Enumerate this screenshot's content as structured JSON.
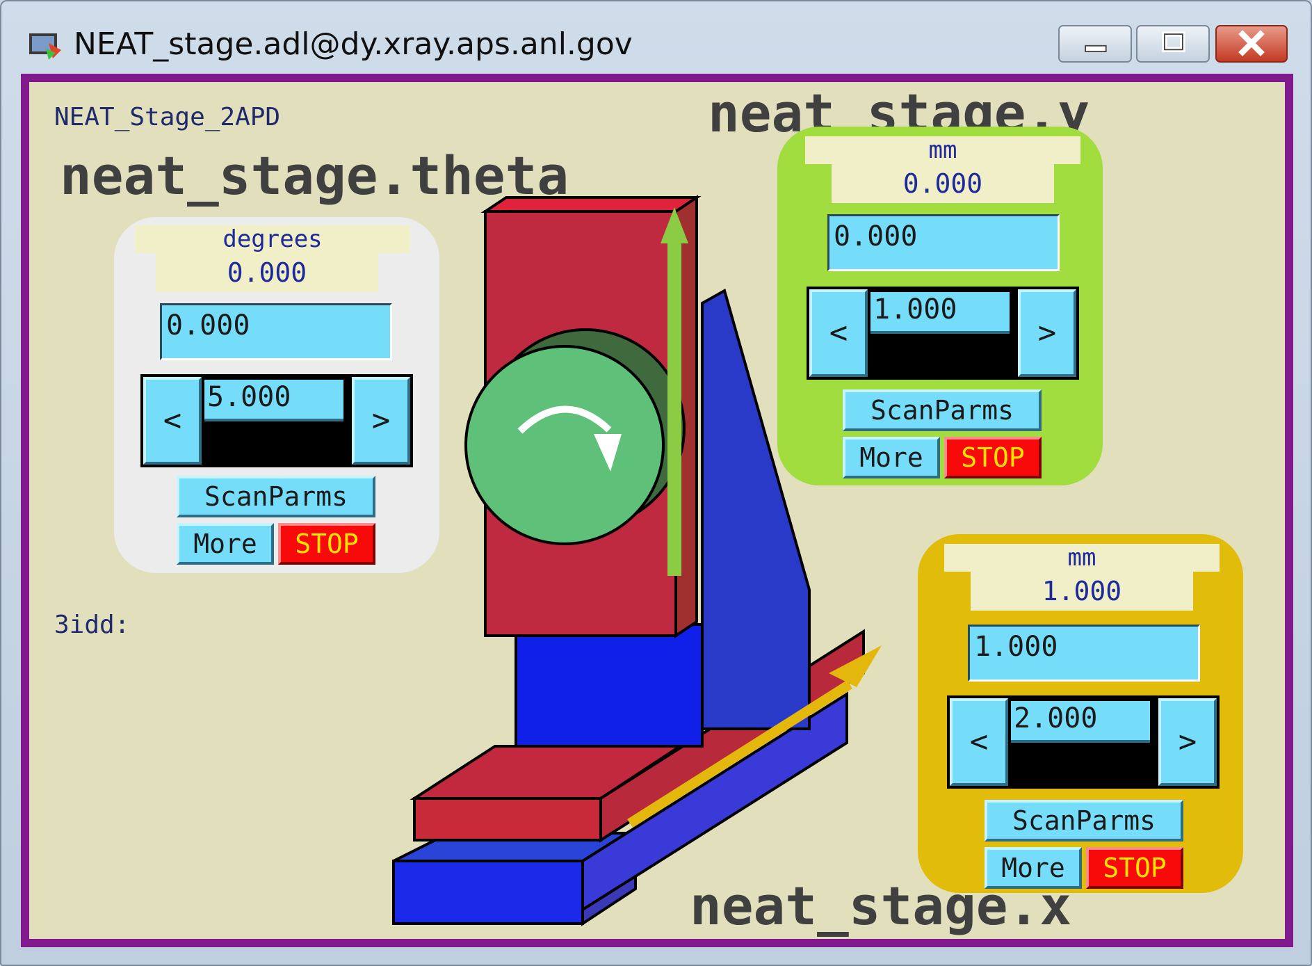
{
  "window": {
    "title": "NEAT_stage.adl@dy.xray.aps.anl.gov",
    "icon": "medm-app-icon",
    "controls": [
      "minimize",
      "maximize",
      "close"
    ]
  },
  "panel": {
    "name": "NEAT_Stage_2APD",
    "prefix": "3idd:",
    "border_color": "#801a8c",
    "background_color": "#e2dfbd"
  },
  "labels": {
    "theta": "neat_stage.theta",
    "y": "neat_stage.y",
    "x": "neat_stage.x"
  },
  "motors": {
    "theta": {
      "units": "degrees",
      "readback": "0.000",
      "setpoint": "0.000",
      "tweak_value": "5.000",
      "tweak_left": "<",
      "tweak_right": ">",
      "scan_label": "ScanParms",
      "more_label": "More",
      "stop_label": "STOP",
      "panel_color": "#ececec"
    },
    "y": {
      "units": "mm",
      "readback": "0.000",
      "setpoint": "0.000",
      "tweak_value": "1.000",
      "tweak_left": "<",
      "tweak_right": ">",
      "scan_label": "ScanParms",
      "more_label": "More",
      "stop_label": "STOP",
      "panel_color": "#a1dd3f"
    },
    "x": {
      "units": "mm",
      "readback": "1.000",
      "setpoint": "1.000",
      "tweak_value": "2.000",
      "tweak_left": "<",
      "tweak_right": ">",
      "scan_label": "ScanParms",
      "more_label": "More",
      "stop_label": "STOP",
      "panel_color": "#e1bc0a"
    }
  }
}
